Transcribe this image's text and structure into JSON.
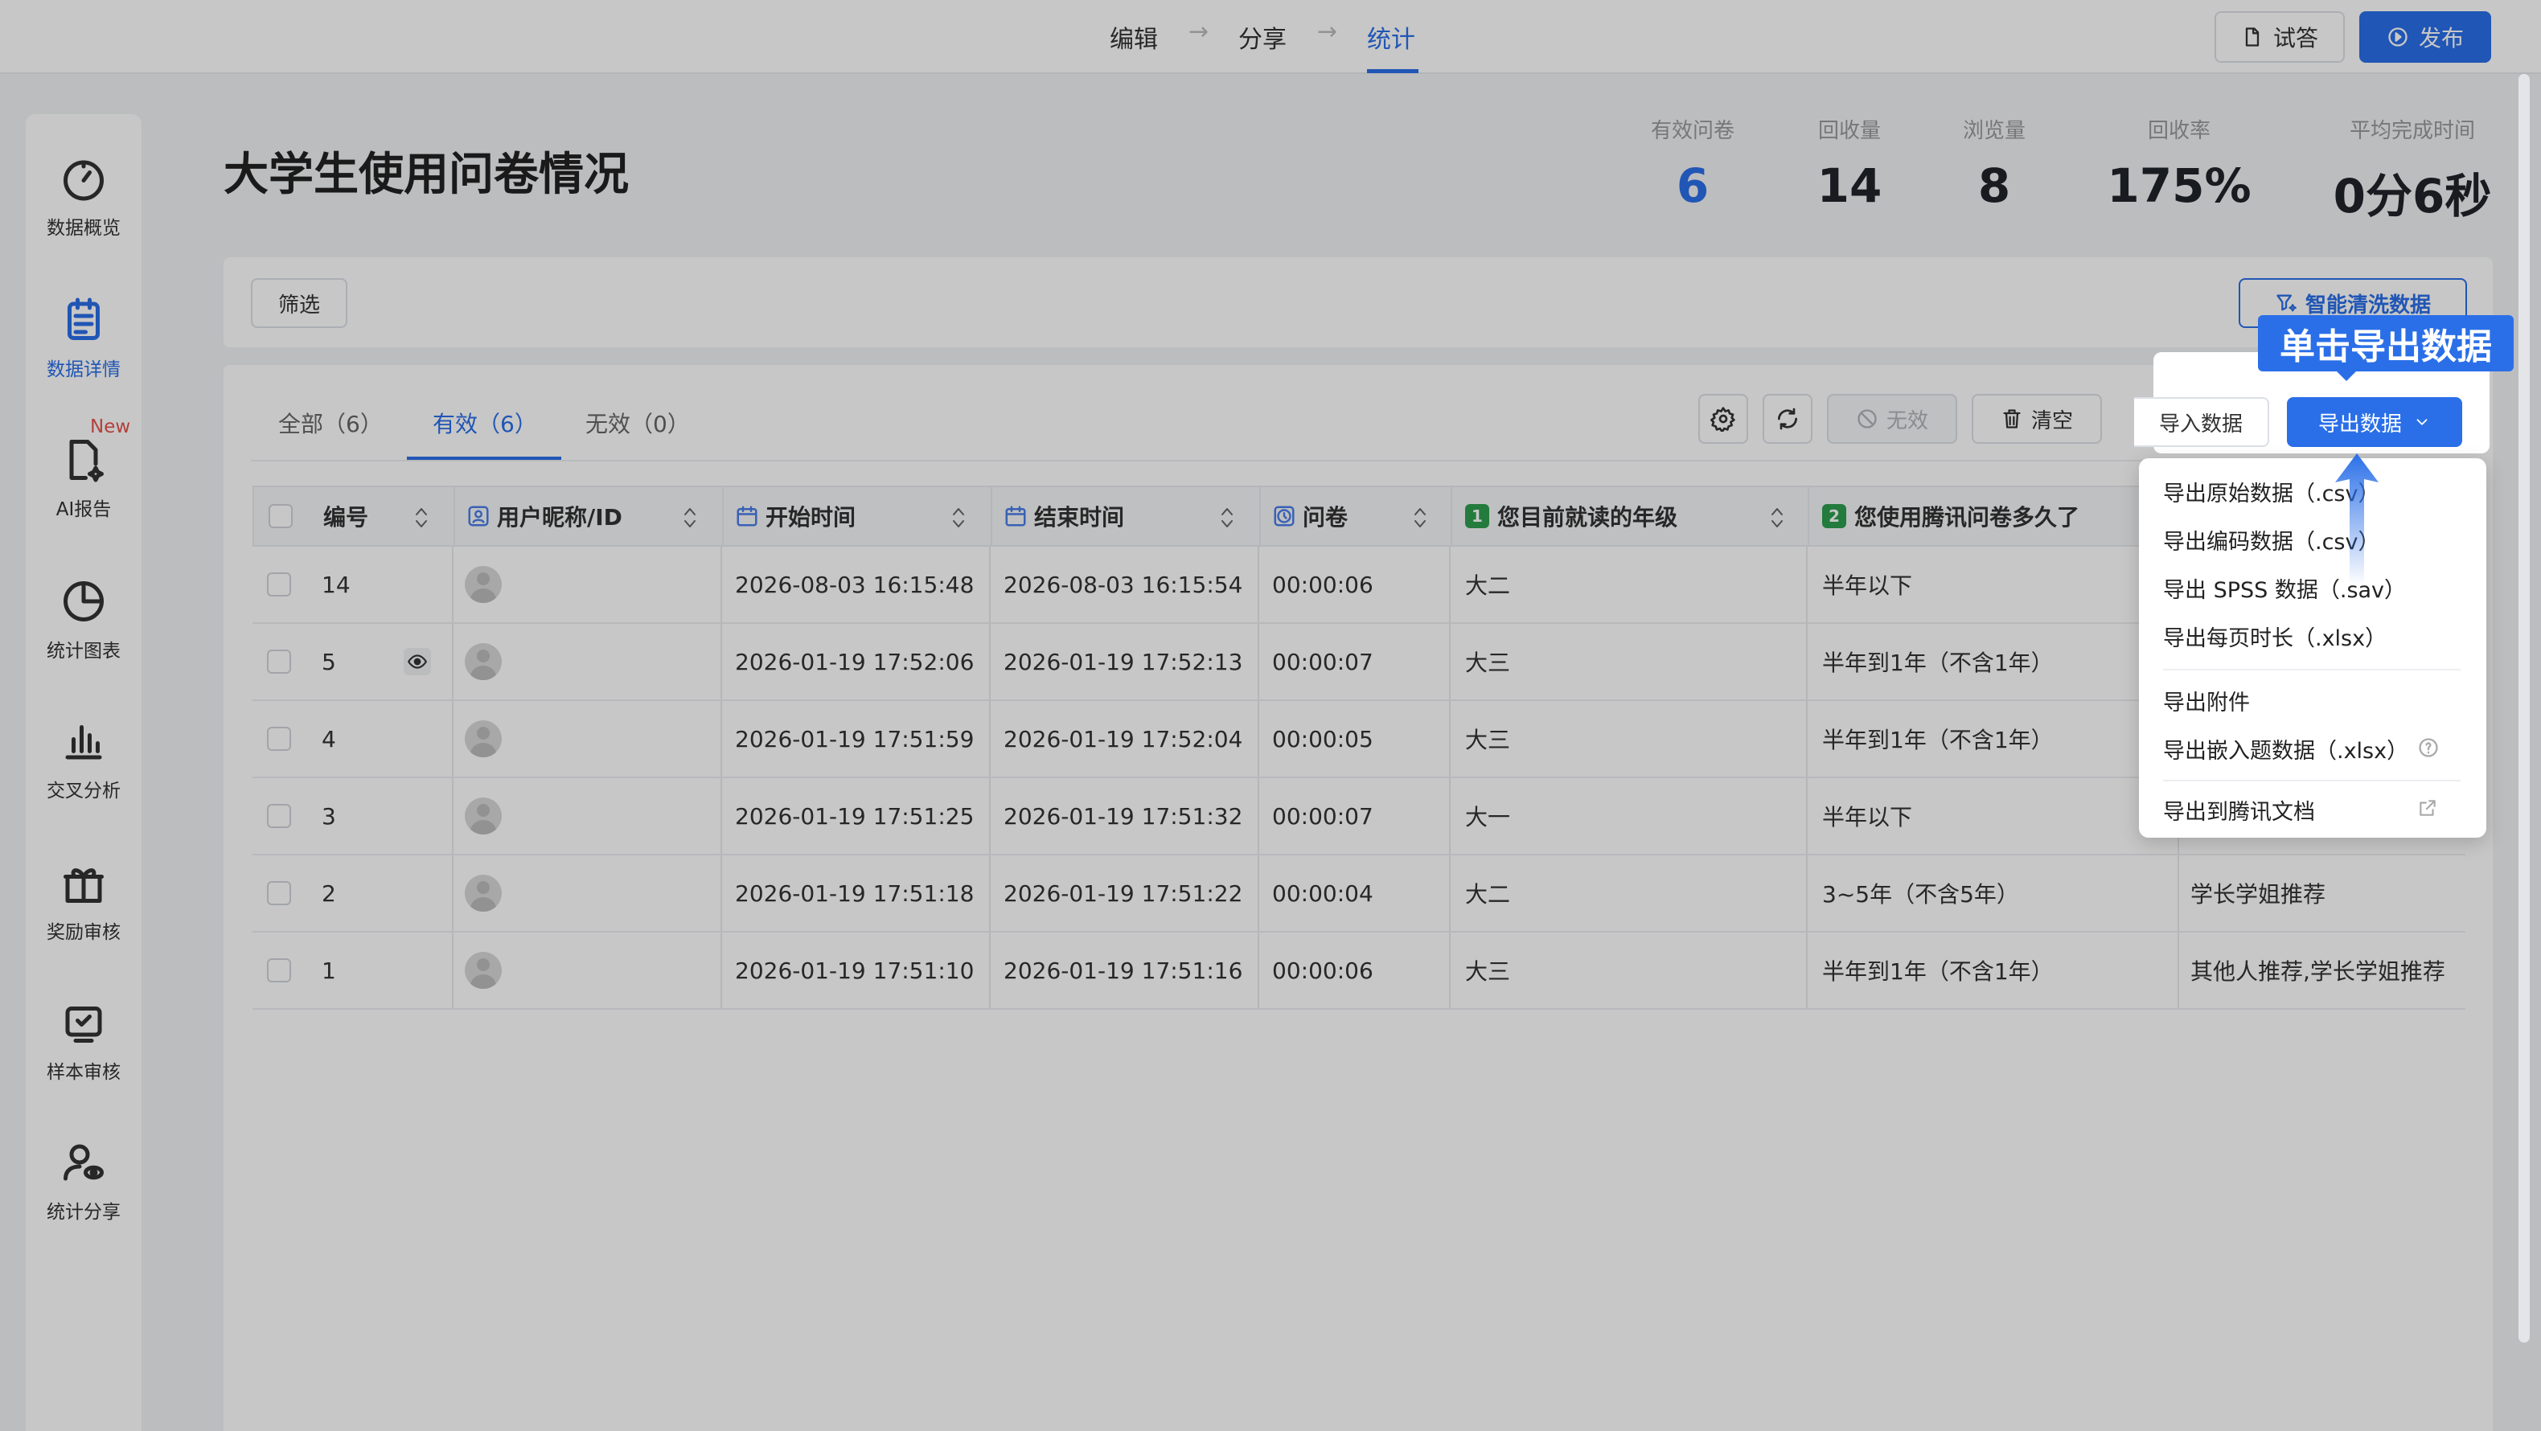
{
  "topbar": {
    "steps": [
      "编辑",
      "分享",
      "统计"
    ],
    "preview_label": "试答",
    "publish_label": "发布"
  },
  "sidebar": {
    "items": [
      {
        "label": "数据概览",
        "icon": "dashboard-icon"
      },
      {
        "label": "数据详情",
        "icon": "document-list-icon"
      },
      {
        "label": "AI报告",
        "icon": "ai-report-icon",
        "badge": "New"
      },
      {
        "label": "统计图表",
        "icon": "pie-chart-icon"
      },
      {
        "label": "交叉分析",
        "icon": "bar-chart-icon"
      },
      {
        "label": "奖励审核",
        "icon": "gift-icon"
      },
      {
        "label": "样本审核",
        "icon": "sample-check-icon"
      },
      {
        "label": "统计分享",
        "icon": "user-share-icon"
      }
    ]
  },
  "page": {
    "title": "大学生使用问卷情况",
    "stats": [
      {
        "label": "有效问卷",
        "value": "6"
      },
      {
        "label": "回收量",
        "value": "14"
      },
      {
        "label": "浏览量",
        "value": "8"
      },
      {
        "label": "回收率",
        "value": "175%"
      },
      {
        "label": "平均完成时间",
        "value": "0分6秒"
      }
    ]
  },
  "filterbar": {
    "filter_label": "筛选",
    "smart_clean_label": "智能清洗数据"
  },
  "tabs": [
    "全部（6）",
    "有效（6）",
    "无效（0）"
  ],
  "toolbar": {
    "invalid_label": "无效",
    "clear_label": "清空",
    "import_label": "导入数据",
    "export_label": "导出数据"
  },
  "table": {
    "headers": [
      "编号",
      "用户昵称/ID",
      "开始时间",
      "结束时间",
      "问卷",
      "您目前就读的年级",
      "您使用腾讯问卷多久了"
    ],
    "rows": [
      {
        "id": "14",
        "start": "2026-08-03 16:15:48",
        "end": "2026-08-03 16:15:54",
        "dur": "00:00:06",
        "grade": "大二",
        "usage": "半年以下",
        "src": ""
      },
      {
        "id": "5",
        "start": "2026-01-19 17:52:06",
        "end": "2026-01-19 17:52:13",
        "dur": "00:00:07",
        "grade": "大三",
        "usage": "半年到1年（不含1年）",
        "src": ""
      },
      {
        "id": "4",
        "start": "2026-01-19 17:51:59",
        "end": "2026-01-19 17:52:04",
        "dur": "00:00:05",
        "grade": "大三",
        "usage": "半年到1年（不含1年）",
        "src": ""
      },
      {
        "id": "3",
        "start": "2026-01-19 17:51:25",
        "end": "2026-01-19 17:51:32",
        "dur": "00:00:07",
        "grade": "大一",
        "usage": "半年以下",
        "src": ""
      },
      {
        "id": "2",
        "start": "2026-01-19 17:51:18",
        "end": "2026-01-19 17:51:22",
        "dur": "00:00:04",
        "grade": "大二",
        "usage": "3~5年（不含5年）",
        "src": "学长学姐推荐"
      },
      {
        "id": "1",
        "start": "2026-01-19 17:51:10",
        "end": "2026-01-19 17:51:16",
        "dur": "00:00:06",
        "grade": "大三",
        "usage": "半年到1年（不含1年）",
        "src": "其他人推荐,学长学姐推荐"
      }
    ]
  },
  "dropdown": {
    "items": [
      "导出原始数据（.csv）",
      "导出编码数据（.csv）",
      "导出 SPSS 数据（.sav）",
      "导出每页时长（.xlsx）",
      "导出附件",
      "导出嵌入题数据（.xlsx）",
      "导出到腾讯文档"
    ]
  },
  "callout": "单击导出数据",
  "colors": {
    "accent": "#2a6fe8",
    "tag_green": "#2e9e4f",
    "badge_red": "#e5534b"
  }
}
